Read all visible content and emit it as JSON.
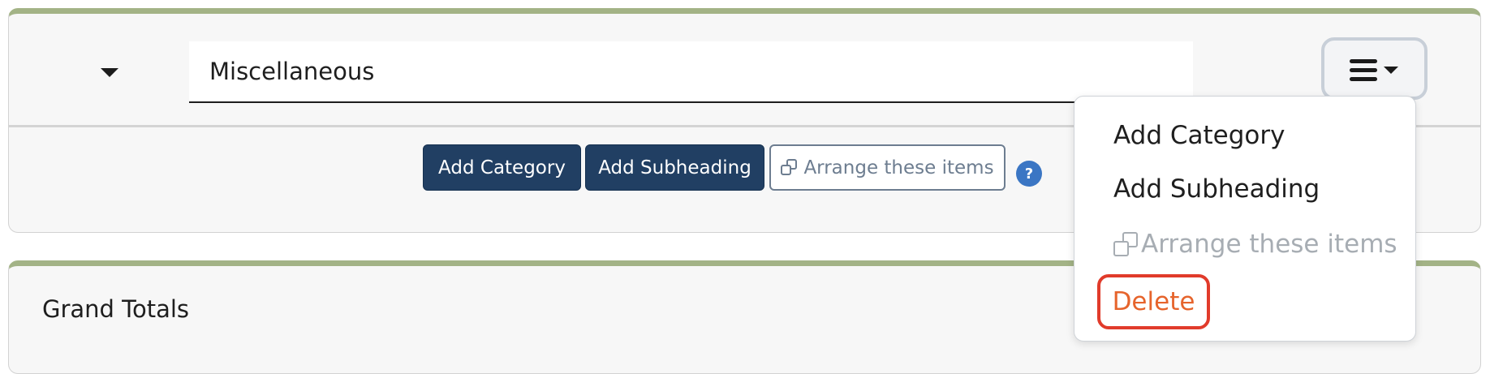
{
  "misc_section": {
    "title_value": "Miscellaneous",
    "collapse_icon": "caret-down-icon",
    "menu_icon": "hamburger-icon",
    "actions": {
      "add_category": "Add Category",
      "add_subheading": "Add Subheading",
      "arrange": "Arrange these items",
      "arrange_icon": "copy-icon",
      "help": "?"
    }
  },
  "dropdown_menu": {
    "items": [
      {
        "label": "Add Category",
        "enabled": true
      },
      {
        "label": "Add Subheading",
        "enabled": true
      },
      {
        "label": "Arrange these items",
        "enabled": false
      },
      {
        "label": "Delete",
        "enabled": true
      }
    ]
  },
  "totals_section": {
    "title": "Grand Totals"
  },
  "colors": {
    "accent_border": "#a3b386",
    "primary_button": "#213f63",
    "outline_button": "#6d7d90",
    "help_icon": "#3b76c4",
    "delete_text": "#e6642c",
    "delete_highlight": "#e13b2b"
  }
}
